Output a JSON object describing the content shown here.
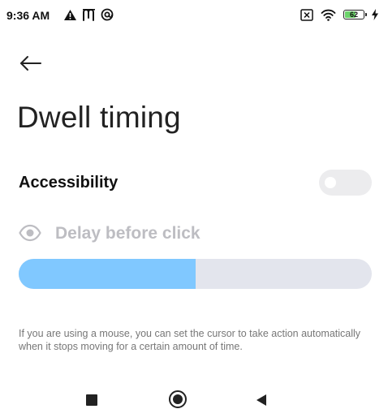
{
  "status_bar": {
    "time": "9:36 AM",
    "battery_level": "62",
    "battery_fraction": 0.62,
    "left_icons": [
      "warning-icon",
      "m-app-icon",
      "at-sign-icon"
    ],
    "right_icons": [
      "sim-x-icon",
      "wifi-icon",
      "battery-icon",
      "charging-icon"
    ]
  },
  "header": {
    "back_icon": "arrow-left-icon",
    "title": "Dwell timing"
  },
  "accessibility": {
    "label": "Accessibility",
    "toggle_on": false
  },
  "delay": {
    "icon": "eye-icon",
    "label": "Delay before click",
    "slider_fraction": 0.5
  },
  "description": "If you are using a mouse, you can set the cursor to take action automatically when it stops moving for a certain amount of time.",
  "nav_bar": {
    "icons": [
      "recents-square-icon",
      "home-circle-icon",
      "back-triangle-icon"
    ]
  },
  "colors": {
    "slider_fill": "#80c8ff",
    "slider_track": "#e3e5ed",
    "battery_fill": "#6cd36b",
    "disabled_text": "#bdbdc2"
  }
}
